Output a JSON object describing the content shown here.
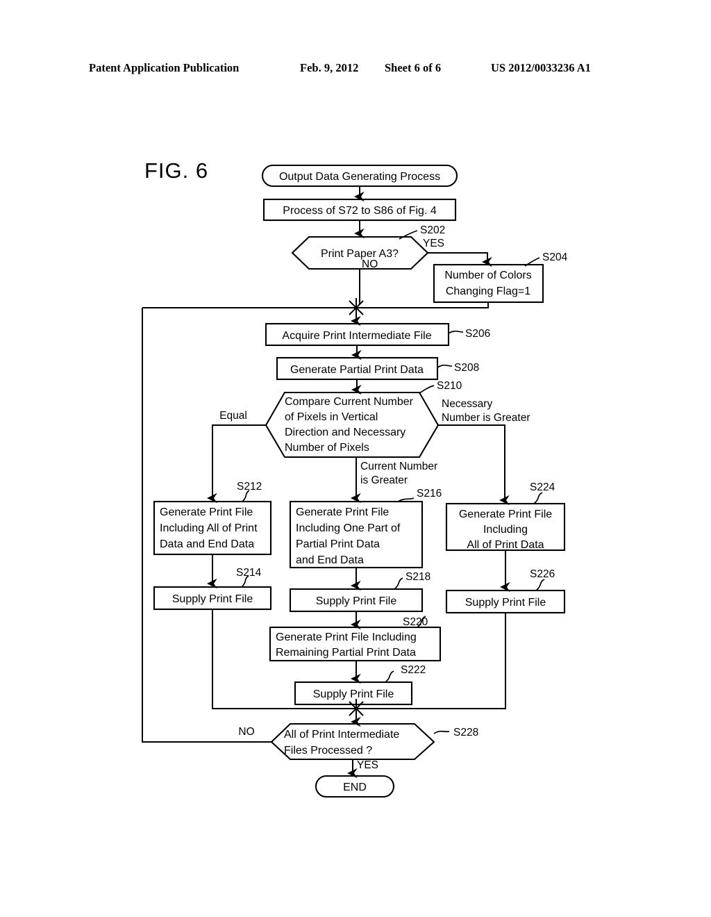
{
  "header": {
    "publication": "Patent Application Publication",
    "date": "Feb. 9, 2012",
    "sheet": "Sheet 6 of 6",
    "number": "US 2012/0033236 A1"
  },
  "figure": {
    "label": "FIG. 6"
  },
  "nodes": {
    "start": {
      "text": "Output Data Generating Process",
      "shape": "terminator"
    },
    "pre_process": {
      "text": "Process of S72 to S86 of Fig. 4",
      "shape": "process"
    },
    "s202": {
      "step": "S202",
      "shape": "decision",
      "text": "Print Paper A3?",
      "yes_label": "YES",
      "no_label": "NO"
    },
    "s204": {
      "step": "S204",
      "shape": "process",
      "line1": "Number of Colors",
      "line2": "Changing Flag=1"
    },
    "s206": {
      "step": "S206",
      "shape": "process",
      "text": "Acquire Print Intermediate File"
    },
    "s208": {
      "step": "S208",
      "shape": "process",
      "text": "Generate Partial Print Data"
    },
    "s210": {
      "step": "S210",
      "shape": "decision",
      "line1": "Compare Current Number",
      "line2": "of Pixels in Vertical",
      "line3": "Direction and Necessary",
      "line4": "Number of Pixels",
      "branch_left": "Equal",
      "branch_right_1": "Necessary",
      "branch_right_2": "Number is Greater",
      "branch_down_1": "Current Number",
      "branch_down_2": "is Greater"
    },
    "s212": {
      "step": "S212",
      "shape": "process",
      "line1": "Generate Print File",
      "line2": "Including All of Print",
      "line3": "Data and End Data"
    },
    "s214": {
      "step": "S214",
      "shape": "process",
      "text": "Supply Print File"
    },
    "s216": {
      "step": "S216",
      "shape": "process",
      "line1": "Generate Print File",
      "line2": "Including One Part of",
      "line3": "Partial Print Data",
      "line4": "and End Data"
    },
    "s218": {
      "step": "S218",
      "shape": "process",
      "text": "Supply Print File"
    },
    "s220": {
      "step": "S220",
      "shape": "process",
      "line1": "Generate Print File Including",
      "line2": "Remaining Partial Print Data"
    },
    "s222": {
      "step": "S222",
      "shape": "process",
      "text": "Supply Print File"
    },
    "s224": {
      "step": "S224",
      "shape": "process",
      "line1": "Generate Print File",
      "line2": "Including",
      "line3": "All of Print Data"
    },
    "s226": {
      "step": "S226",
      "shape": "process",
      "text": "Supply Print File"
    },
    "s228": {
      "step": "S228",
      "shape": "decision",
      "line1": "All of Print Intermediate",
      "line2": "Files Processed ?",
      "no_label": "NO",
      "yes_label": "YES"
    },
    "end": {
      "text": "END",
      "shape": "terminator"
    }
  },
  "colors": {
    "ink": "#000000",
    "paper": "#ffffff"
  }
}
